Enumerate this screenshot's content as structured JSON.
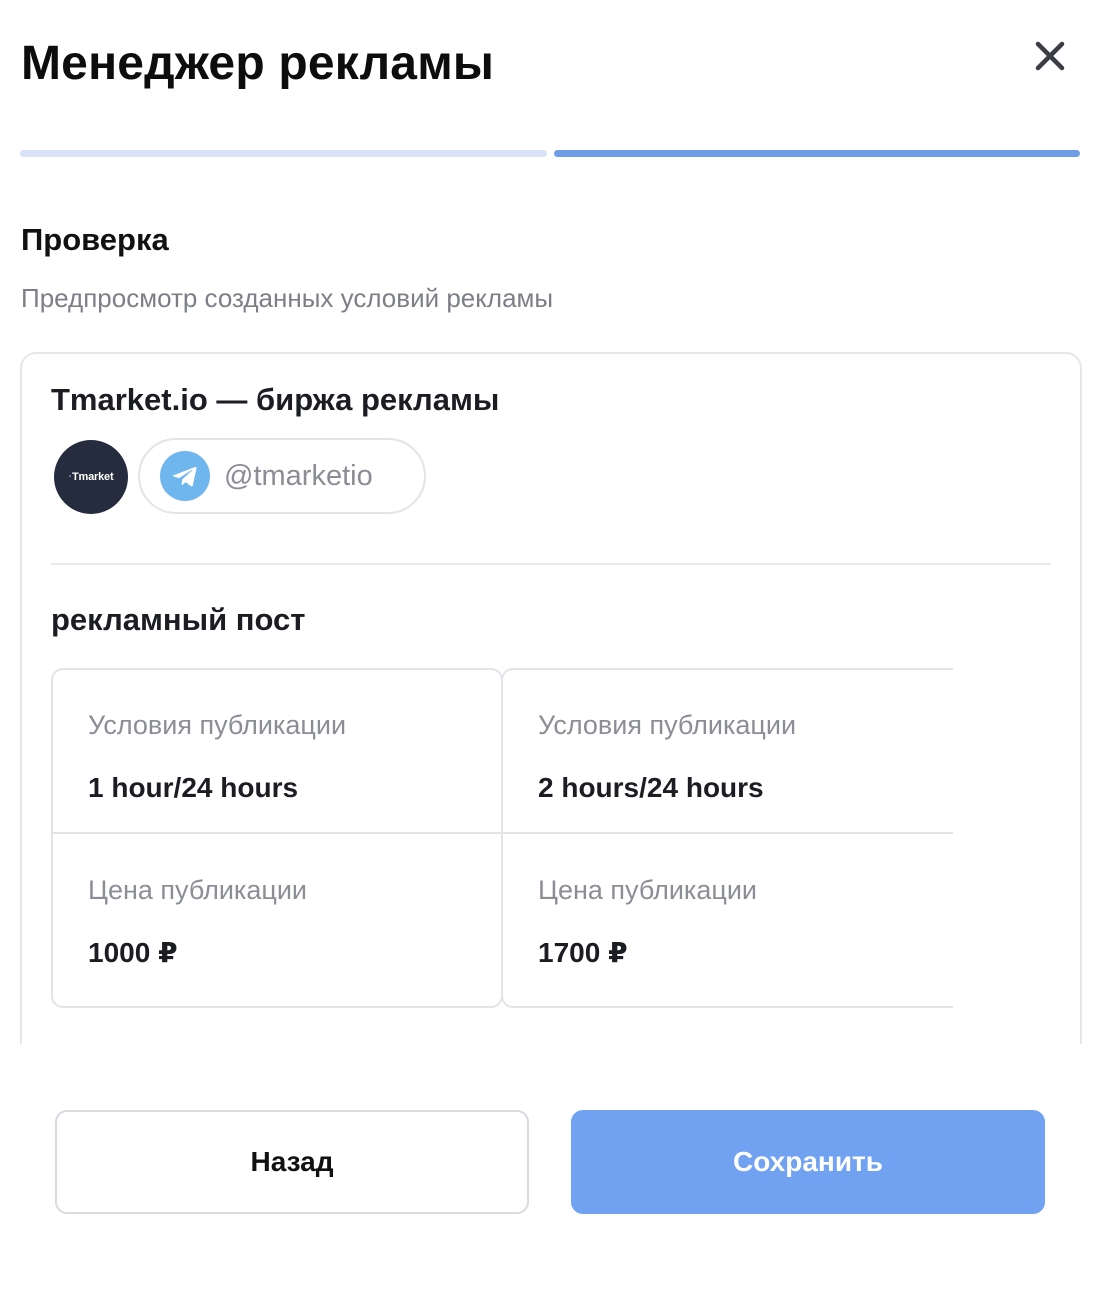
{
  "header": {
    "title": "Менеджер рекламы",
    "close_icon": "close-icon"
  },
  "progress": {
    "steps_total": 2,
    "current_step": 2,
    "completed_color": "#d8e3fa",
    "active_color": "#6e9de6"
  },
  "section": {
    "title": "Проверка",
    "subtitle": "Предпросмотр созданных условий рекламы"
  },
  "channel": {
    "name": "Tmarket.io — биржа рекламы",
    "avatar_text": "Tmarket",
    "handle": "@tmarketio",
    "handle_icon": "telegram-icon"
  },
  "post": {
    "type": "рекламный пост",
    "offers": [
      {
        "conditions_label": "Условия публикации",
        "conditions_value": "1 hour/24 hours",
        "price_label": "Цена публикации",
        "price_value": "1000 ₽"
      },
      {
        "conditions_label": "Условия публикации",
        "conditions_value": "2 hours/24 hours",
        "price_label": "Цена публикации",
        "price_value": "1700 ₽"
      }
    ]
  },
  "footer": {
    "back_label": "Назад",
    "save_label": "Сохранить",
    "save_color": "#71a2f2"
  }
}
